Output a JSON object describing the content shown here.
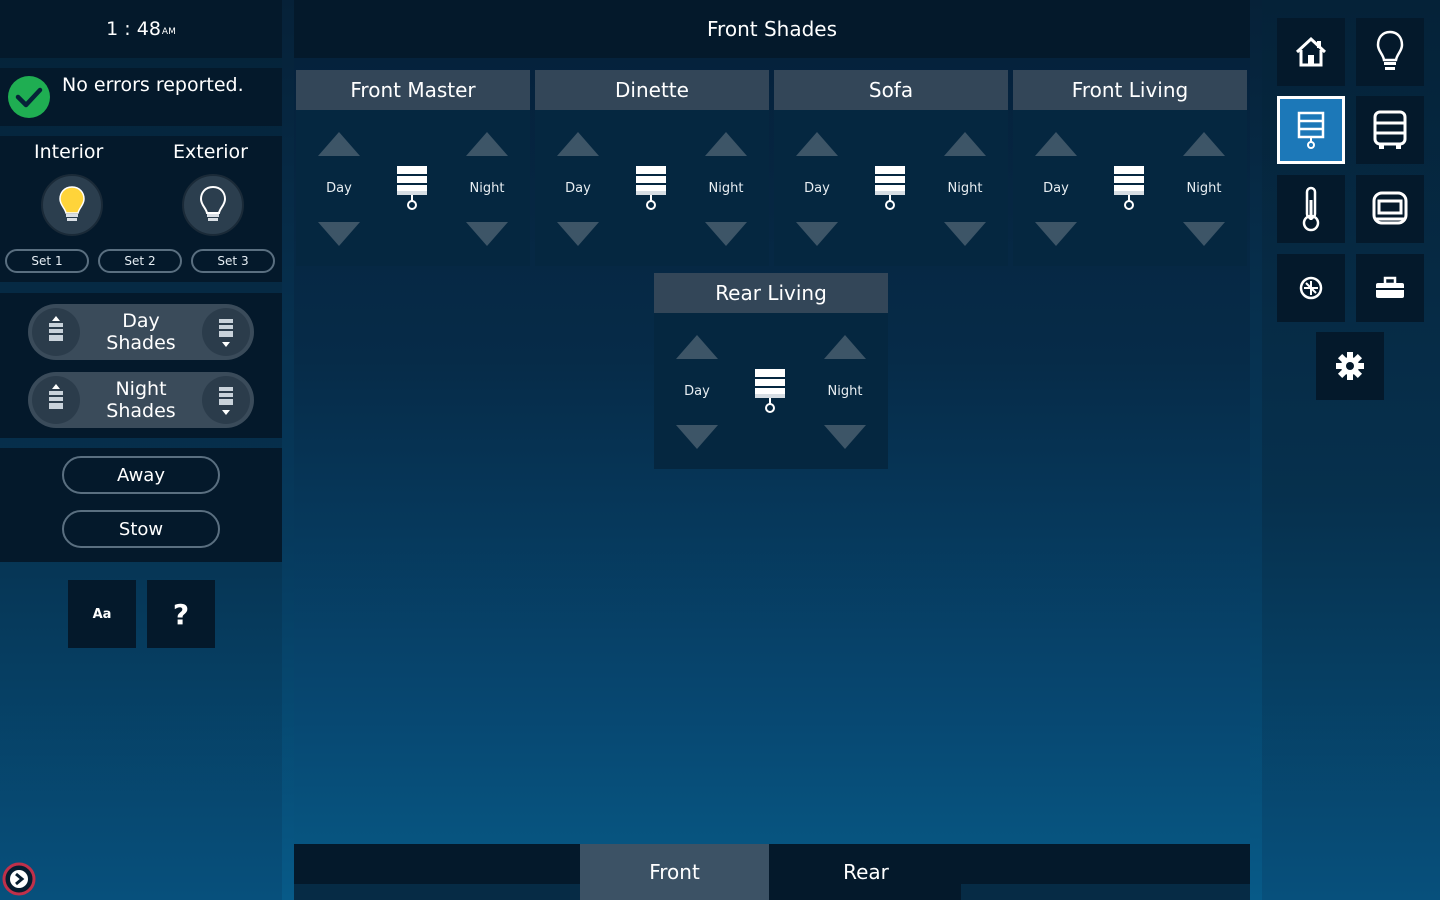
{
  "clock": {
    "time": "1 : 48",
    "ampm": "AM"
  },
  "status": {
    "message": "No errors reported."
  },
  "lights": {
    "interior_label": "Interior",
    "exterior_label": "Exterior",
    "sets": [
      "Set 1",
      "Set 2",
      "Set 3"
    ]
  },
  "shade_groups": [
    {
      "label_line1": "Day",
      "label_line2": "Shades"
    },
    {
      "label_line1": "Night",
      "label_line2": "Shades"
    }
  ],
  "modes": {
    "away": "Away",
    "stow": "Stow"
  },
  "tools": {
    "font_label": "Aa",
    "help_label": "?"
  },
  "header": {
    "title": "Front Shades"
  },
  "shades": [
    {
      "name": "Front Master",
      "day": "Day",
      "night": "Night"
    },
    {
      "name": "Dinette",
      "day": "Day",
      "night": "Night"
    },
    {
      "name": "Sofa",
      "day": "Day",
      "night": "Night"
    },
    {
      "name": "Front Living",
      "day": "Day",
      "night": "Night"
    },
    {
      "name": "Rear Living",
      "day": "Day",
      "night": "Night"
    }
  ],
  "tabs": [
    {
      "label": "Front",
      "active": true
    },
    {
      "label": "Rear",
      "active": false
    }
  ],
  "nav": [
    "home-icon",
    "lightbulb-icon",
    "shade-icon",
    "bus-icon",
    "thermometer-icon",
    "coach-icon",
    "fan-icon",
    "toolbox-icon",
    "gear-icon"
  ],
  "colors": {
    "panel": "#04192b",
    "selected": "#1c78b8",
    "card_header": "#334658",
    "arrow": "#3d5567"
  }
}
